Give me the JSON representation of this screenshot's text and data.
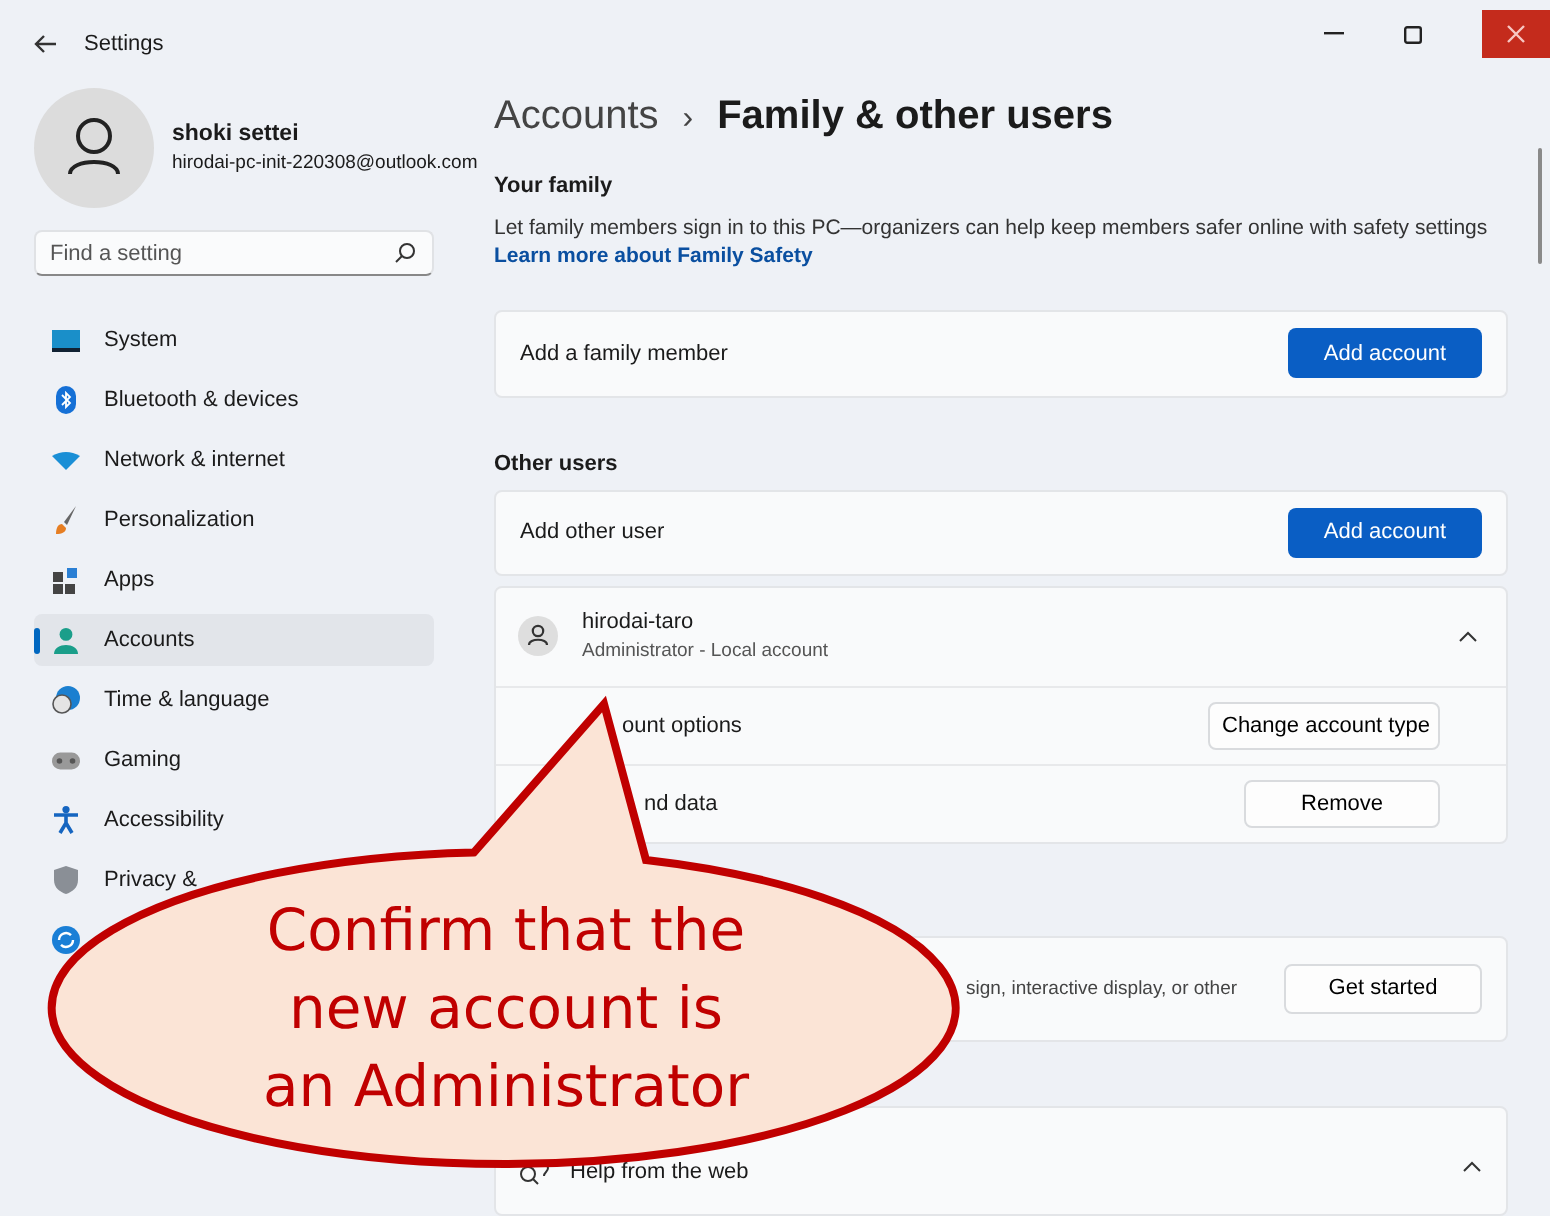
{
  "window": {
    "title": "Settings"
  },
  "profile": {
    "name": "shoki settei",
    "email": "hirodai-pc-init-220308@outlook.com"
  },
  "search": {
    "placeholder": "Find a setting"
  },
  "sidebar": {
    "items": [
      {
        "kind": "system",
        "label": "System",
        "selected": false
      },
      {
        "kind": "bluetooth",
        "label": "Bluetooth & devices",
        "selected": false
      },
      {
        "kind": "network",
        "label": "Network & internet",
        "selected": false
      },
      {
        "kind": "personalization",
        "label": "Personalization",
        "selected": false
      },
      {
        "kind": "apps",
        "label": "Apps",
        "selected": false
      },
      {
        "kind": "accounts",
        "label": "Accounts",
        "selected": true
      },
      {
        "kind": "time",
        "label": "Time & language",
        "selected": false
      },
      {
        "kind": "gaming",
        "label": "Gaming",
        "selected": false
      },
      {
        "kind": "accessibility",
        "label": "Accessibility",
        "selected": false
      },
      {
        "kind": "privacy",
        "label": "Privacy &",
        "selected": false
      },
      {
        "kind": "update",
        "selected": false
      }
    ]
  },
  "breadcrumb": {
    "parent": "Accounts",
    "separator": "›",
    "current": "Family & other users"
  },
  "your_family": {
    "heading": "Your family",
    "description": "Let family members sign in to this PC—organizers can help keep members safer online with safety settings",
    "link": "Learn more about Family Safety",
    "row": {
      "label": "Add a family member",
      "button": "Add account"
    }
  },
  "other_users": {
    "heading": "Other users",
    "row": {
      "label": "Add other user",
      "button": "Add account"
    },
    "users": [
      {
        "name": "hirodai-taro",
        "detail": "Administrator - Local account",
        "expanded": true,
        "options": [
          {
            "label": "ount options",
            "button": "Change account type"
          },
          {
            "label": "nd data",
            "button": "Remove"
          }
        ]
      }
    ]
  },
  "kiosk": {
    "description": "sign, interactive display, or other",
    "button": "Get started"
  },
  "help": {
    "label": "Help from the web",
    "expanded": true
  },
  "callout": {
    "text": "Confirm that the\nnew account is\nan Administrator"
  }
}
